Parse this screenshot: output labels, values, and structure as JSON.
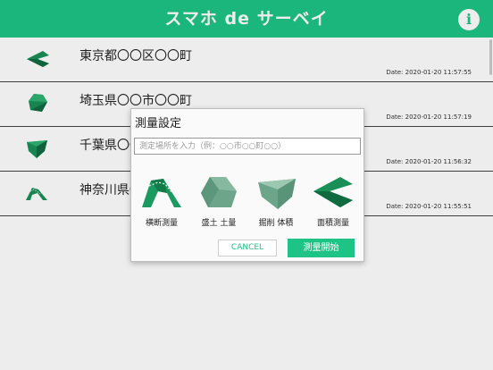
{
  "header": {
    "title": "スマホ de サーベイ",
    "info_icon": "info-icon",
    "color": "#1ec485"
  },
  "surveys": [
    {
      "name": "東京都〇〇区〇〇町",
      "date": "Date: 2020-01-20 11:57:55",
      "icon": "area-survey-icon"
    },
    {
      "name": "埼玉県〇〇市〇〇町",
      "date": "Date: 2020-01-20 11:57:19",
      "icon": "fill-volume-icon"
    },
    {
      "name": "千葉県〇〇市〇〇町",
      "date": "Date: 2020-01-20 11:56:32",
      "icon": "cut-volume-icon"
    },
    {
      "name": "神奈川県〇〇市〇〇町",
      "date": "Date: 2020-01-20 11:55:51",
      "icon": "cross-section-icon"
    }
  ],
  "dialog": {
    "title": "測量設定",
    "place_placeholder": "測定場所を入力（例：○○市○○町○○）",
    "modes": [
      {
        "label": "横断測量",
        "icon": "cross-section-icon"
      },
      {
        "label": "盛土 土量",
        "icon": "fill-volume-icon"
      },
      {
        "label": "掘削 体積",
        "icon": "cut-volume-icon"
      },
      {
        "label": "面積測量",
        "icon": "area-survey-icon"
      }
    ],
    "cancel_label": "CANCEL",
    "start_label": "測量開始"
  }
}
